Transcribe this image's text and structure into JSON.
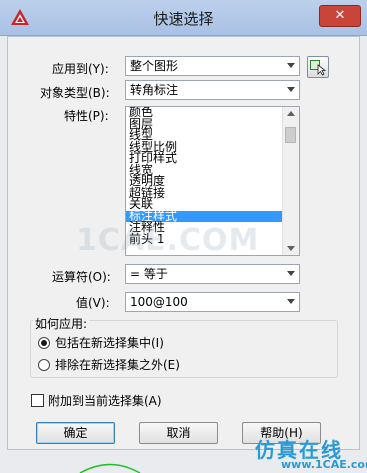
{
  "window": {
    "title": "快速选择",
    "close_label": "✕"
  },
  "form": {
    "apply_to": {
      "label": "应用到(Y):",
      "value": "整个图形"
    },
    "object_type": {
      "label": "对象类型(B):",
      "value": "转角标注"
    },
    "properties": {
      "label": "特性(P):",
      "items": [
        "颜色",
        "图层",
        "线型",
        "线型比例",
        "打印样式",
        "线宽",
        "透明度",
        "超链接",
        "关联",
        "标注样式",
        "注释性",
        "前头 1"
      ],
      "selected_index": 9
    },
    "operator": {
      "label": "运算符(O):",
      "value": "= 等于"
    },
    "value": {
      "label": "值(V):",
      "value": "100@100"
    }
  },
  "how_to_apply": {
    "title": "如何应用:",
    "options": [
      "包括在新选择集中(I)",
      "排除在新选择集之外(E)"
    ],
    "selected_index": 0
  },
  "append": {
    "label": "附加到当前选择集(A)",
    "checked": false
  },
  "buttons": {
    "ok": "确定",
    "cancel": "取消",
    "help": "帮助(H)"
  },
  "watermarks": {
    "center": "1CAE.COM",
    "brand": "仿真在线",
    "site": "www.1CAE.com"
  }
}
